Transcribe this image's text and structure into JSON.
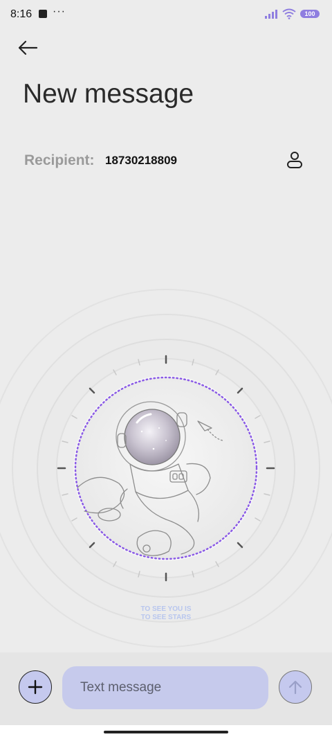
{
  "status_bar": {
    "time": "8:16",
    "more_indicator": "···",
    "battery": "100",
    "icons": [
      "notification-square-icon",
      "signal-icon",
      "wifi-icon",
      "battery-icon"
    ]
  },
  "header": {
    "title": "New message",
    "back_icon": "arrow-left-icon"
  },
  "recipient": {
    "label": "Recipient:",
    "value": "18730218809",
    "contact_icon": "person-icon"
  },
  "wallpaper": {
    "tagline_line1": "TO SEE YOU IS",
    "tagline_line2": "TO SEE STARS",
    "accent": "#8a5ae6"
  },
  "composer": {
    "placeholder": "Text message",
    "add_icon": "plus-icon",
    "send_icon": "arrow-up-icon",
    "accent": "#c5c9ee"
  }
}
